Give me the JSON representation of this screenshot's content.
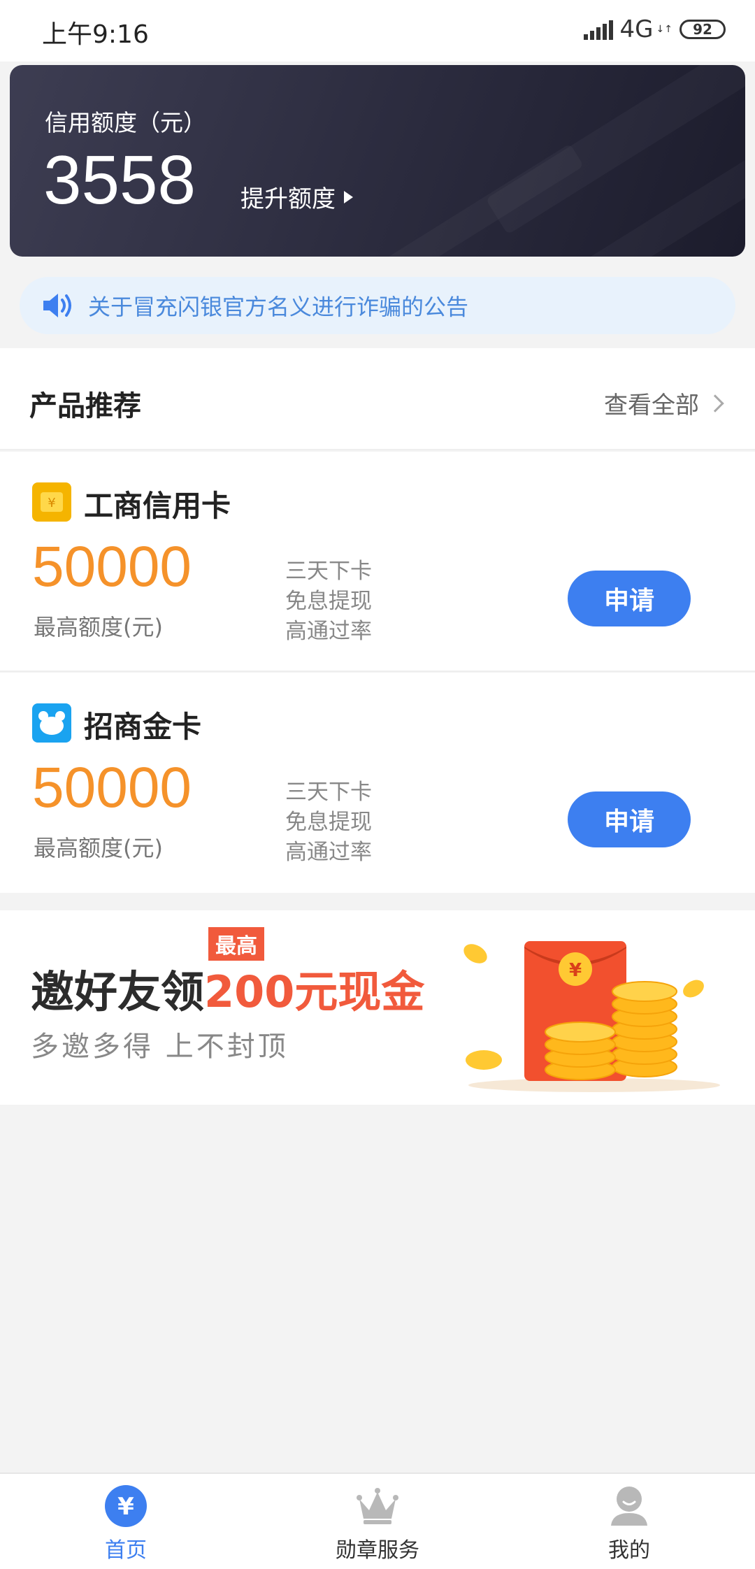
{
  "status_bar": {
    "time": "上午9:16",
    "network": "4G",
    "battery": "92"
  },
  "credit": {
    "label": "信用额度（元）",
    "amount": "3558",
    "raise_label": "提升额度"
  },
  "notice": {
    "text": "关于冒充闪银官方名义进行诈骗的公告"
  },
  "section": {
    "title": "产品推荐",
    "see_all": "查看全部"
  },
  "products": [
    {
      "name": "工商信用卡",
      "amount": "50000",
      "amount_label": "最高额度(元)",
      "features": [
        "三天下卡",
        "免息提现",
        "高通过率"
      ],
      "button": "申请",
      "icon": "yen-icon",
      "icon_color": "#f5b400"
    },
    {
      "name": "招商金卡",
      "amount": "50000",
      "amount_label": "最高额度(元)",
      "features": [
        "三天下卡",
        "免息提现",
        "高通过率"
      ],
      "button": "申请",
      "icon": "bear-icon",
      "icon_color": "#1aa3f0"
    }
  ],
  "invite": {
    "title": "邀好友领",
    "highlight": "200元现金",
    "tag": "最高",
    "subtitle": "多邀多得   上不封顶"
  },
  "tabs": [
    {
      "label": "首页",
      "icon": "yen-circle-icon",
      "active": true
    },
    {
      "label": "勋章服务",
      "icon": "crown-icon",
      "active": false
    },
    {
      "label": "我的",
      "icon": "user-icon",
      "active": false
    }
  ],
  "colors": {
    "accent": "#3d7ff0",
    "amount": "#f5922a",
    "highlight": "#f15a3c",
    "notice_text": "#4a89dc"
  }
}
